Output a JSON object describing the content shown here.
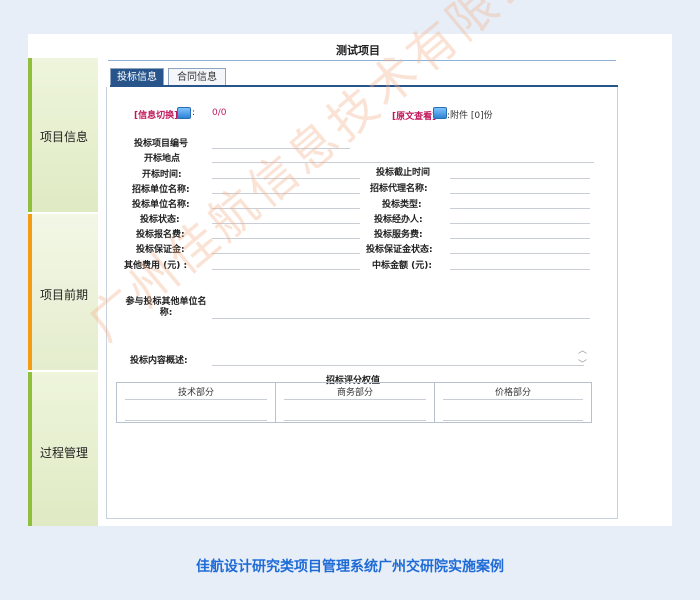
{
  "nav": [
    {
      "label": "项目信息"
    },
    {
      "label": "项目前期"
    },
    {
      "label": "过程管理"
    }
  ],
  "page": {
    "title": "测试项目"
  },
  "tabs": [
    {
      "label": "投标信息"
    },
    {
      "label": "合同信息"
    }
  ],
  "info_switch": {
    "label": "[信息切换]",
    "colon": ":",
    "value": "0/0"
  },
  "original_view": {
    "label": "[原文查看]",
    "attachment": ":附件 [0]份"
  },
  "fields": {
    "bid_project_no": "投标项目编号",
    "open_location": "开标地点",
    "open_time": "开标时间:",
    "bid_deadline": "投标截止时间",
    "tender_unit": "招标单位名称:",
    "tender_agent": "招标代理名称:",
    "bid_unit": "投标单位名称:",
    "bid_type": "投标类型:",
    "bid_status": "投标状态:",
    "bid_handler": "投标经办人:",
    "bid_fee": "投标报名费:",
    "bid_service_fee": "投标服务费:",
    "bid_deposit": "投标保证金:",
    "deposit_status": "投标保证金状态:",
    "other_fee": "其他费用 (元) :",
    "win_amount": "中标金额 (元):",
    "other_units": "参与投标其他单位名称:",
    "bid_content": "投标内容概述:"
  },
  "score": {
    "title": "招标评分权值",
    "columns": [
      "技术部分",
      "商务部分",
      "价格部分"
    ]
  },
  "caption": "佳航设计研究类项目管理系统广州交研院实施案例",
  "watermark": "广州佳航信息技术有限公司",
  "colors": {
    "nav_green": "#8fbf3c",
    "nav_active": "#f39c12",
    "tab_blue": "#27548a",
    "caption_blue": "#1f6bd6",
    "pink": "#c2185b"
  }
}
